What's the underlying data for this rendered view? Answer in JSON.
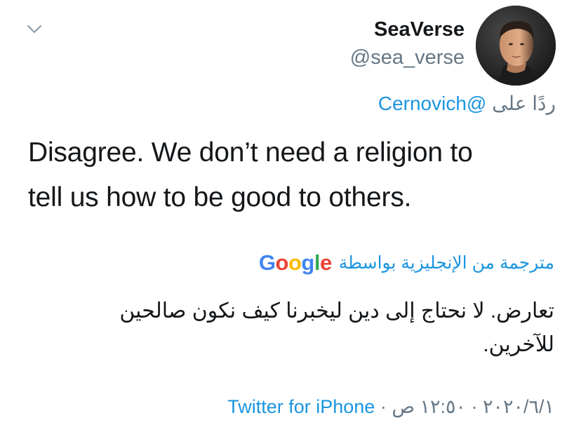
{
  "header": {
    "chevron_icon": "chevron-down-icon",
    "display_name": "SeaVerse",
    "handle": "@sea_verse",
    "avatar_icon": "avatar-photo"
  },
  "reply": {
    "prefix": "ردًا على",
    "mention": "@Cernovich"
  },
  "tweet": {
    "text_line1": "Disagree. We don’t need a religion to",
    "text_line2": "tell us how to be good to others."
  },
  "translation": {
    "label": "مترجمة من الإنجليزية بواسطة",
    "google_letters": [
      "G",
      "o",
      "o",
      "g",
      "l",
      "e"
    ],
    "text_line1": "تعارض. لا نحتاج إلى دين ليخبرنا كيف نكون صالحين",
    "text_line2": "للآخرين."
  },
  "meta": {
    "date": "٢٠٢٠/٦/١",
    "separator1": " · ",
    "time": "١٢:٥٠ ص",
    "separator2": " · ",
    "source": "Twitter for iPhone"
  },
  "colors": {
    "link_blue": "#1b95e0",
    "secondary_gray": "#657786",
    "text_dark": "#14171a",
    "google_blue": "#4285F4",
    "google_red": "#EA4335",
    "google_yellow": "#FBBC05",
    "google_green": "#34A853"
  }
}
